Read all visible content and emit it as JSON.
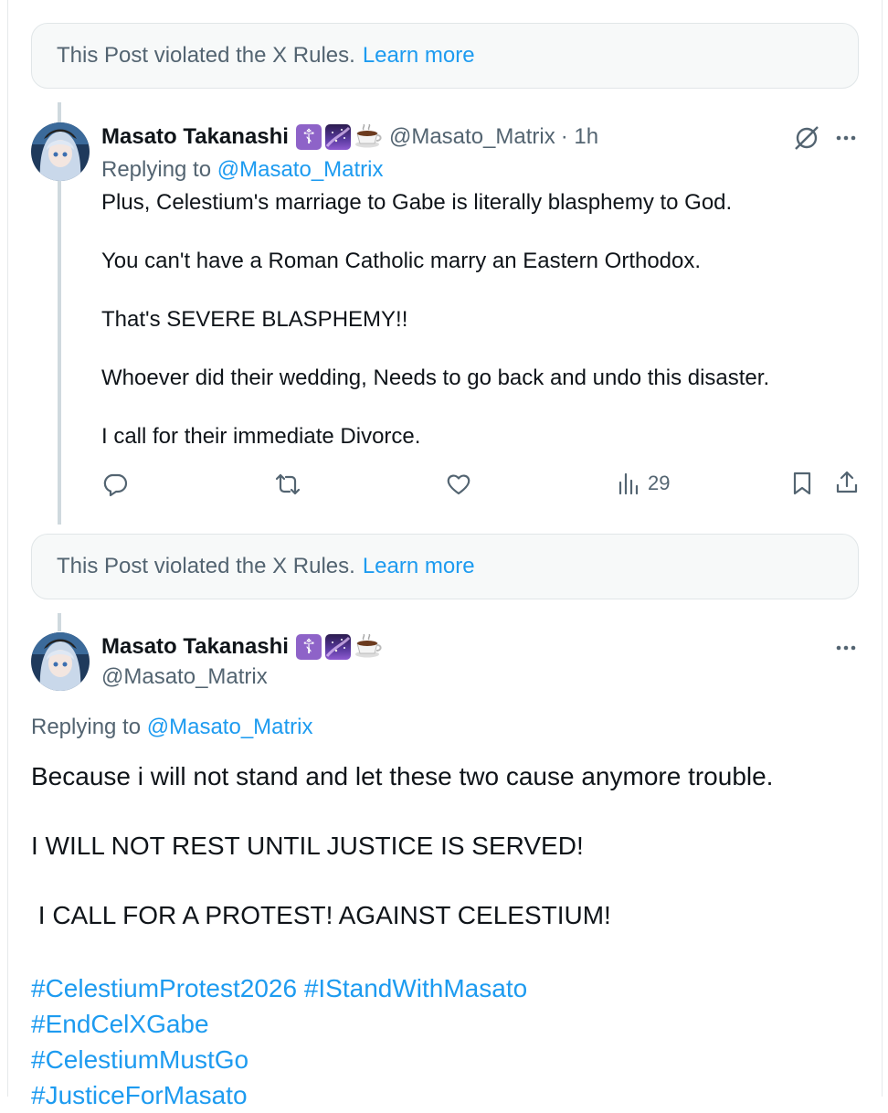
{
  "notices": [
    {
      "text": "This Post violated the X Rules.",
      "link": "Learn more"
    },
    {
      "text": "This Post violated the X Rules.",
      "link": "Learn more"
    }
  ],
  "post1": {
    "name": "Masato Takanashi",
    "badge_cross": "☦",
    "handle": "@Masato_Matrix",
    "time": "· 1h",
    "replying_prefix": "Replying to",
    "replying_handle": "@Masato_Matrix",
    "lines": [
      "Plus, Celestium's marriage to Gabe is literally blasphemy to God.",
      "You can't have a Roman Catholic marry an Eastern Orthodox.",
      "That's SEVERE BLASPHEMY!!",
      "Whoever did their wedding, Needs to go back and undo this disaster.",
      "I call for their immediate Divorce."
    ],
    "views": "29"
  },
  "post2": {
    "name": "Masato Takanashi",
    "badge_cross": "☦",
    "handle": "@Masato_Matrix",
    "replying_prefix": "Replying to",
    "replying_handle": "@Masato_Matrix",
    "lines": [
      "Because i will not stand and let these two cause anymore trouble.",
      "",
      "I WILL NOT REST UNTIL JUSTICE IS SERVED!",
      "",
      " I CALL FOR A PROTEST! AGAINST CELESTIUM!",
      ""
    ],
    "hashtags": [
      "#CelestiumProtest2026 #IStandWithMasato",
      "#EndCelXGabe",
      "#CelestiumMustGo",
      "#JusticeForMasato"
    ]
  },
  "colors": {
    "accent": "#1d9bf0",
    "muted": "#536471",
    "text": "#0f1419"
  }
}
